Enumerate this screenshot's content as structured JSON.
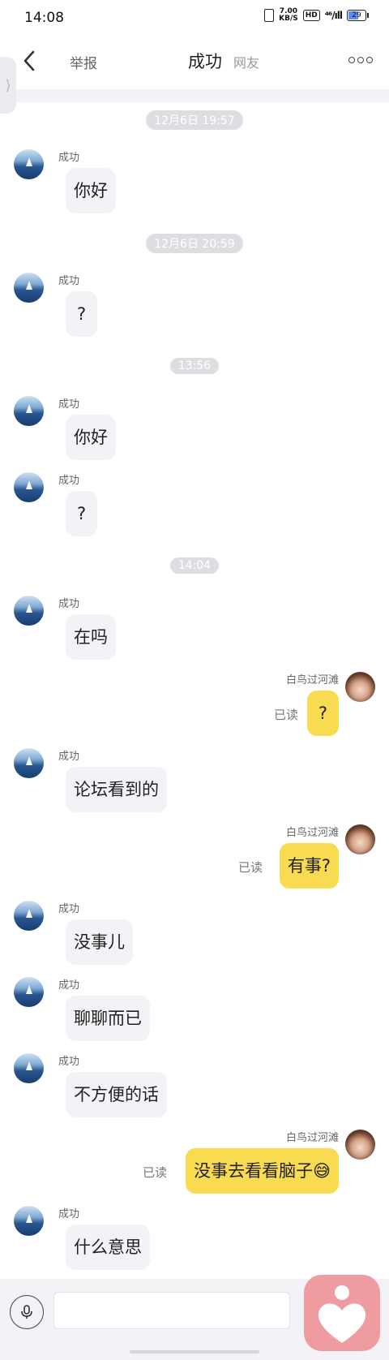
{
  "status_bar": {
    "time": "14:08",
    "net_speed_value": "7.00",
    "net_speed_unit": "KB/S",
    "hd_label": "HD",
    "signal_label": "⁴⁶/ıll",
    "battery_level": "29",
    "battery_color": "#5b8ef5"
  },
  "header": {
    "report_label": "举报",
    "title": "成功",
    "subtitle": "网友"
  },
  "timestamps": [
    "12月6日 19:57",
    "12月6日 20:59",
    "13:56",
    "14:04"
  ],
  "contact_name": "成功",
  "self_name": "白鸟过河滩",
  "read_label": "已读",
  "messages": [
    {
      "text": "你好"
    },
    {
      "text": "?"
    },
    {
      "text": "你好"
    },
    {
      "text": "?"
    },
    {
      "text": "在吗"
    },
    {
      "text": "?"
    },
    {
      "text": "论坛看到的"
    },
    {
      "text": "有事?"
    },
    {
      "text": "没事儿"
    },
    {
      "text": "聊聊而已"
    },
    {
      "text": "不方便的话"
    },
    {
      "text": "没事去看看脑子😅"
    },
    {
      "text": "什么意思"
    }
  ],
  "input": {
    "value": "",
    "placeholder": ""
  },
  "colors": {
    "outgoing_bubble": "#f9db52",
    "incoming_bubble": "#f3f3f7",
    "fab": "#ef9ca0"
  },
  "icons": [
    "back-arrow-icon",
    "more-icon",
    "mic-icon",
    "heart-person-icon",
    "side-expand-icon"
  ]
}
